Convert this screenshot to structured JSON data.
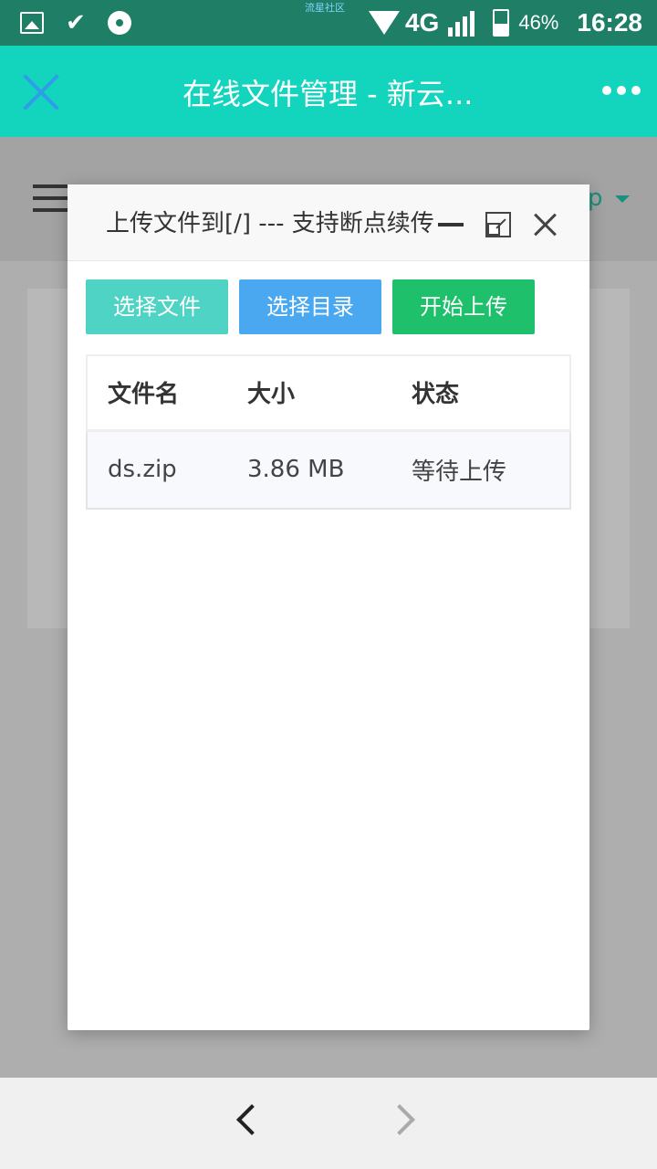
{
  "status_bar": {
    "watermark": "流星社区",
    "network": "4G",
    "battery": "46%",
    "time": "16:28"
  },
  "header": {
    "title": "在线文件管理 - 新云..."
  },
  "background": {
    "user_menu_label": "p"
  },
  "modal": {
    "title": "上传文件到[/] --- 支持断点续传",
    "buttons": {
      "select_file": "选择文件",
      "select_dir": "选择目录",
      "start_upload": "开始上传"
    },
    "table": {
      "columns": [
        "文件名",
        "大小",
        "状态"
      ],
      "rows": [
        {
          "name": "ds.zip",
          "size": "3.86 MB",
          "status": "等待上传"
        }
      ]
    }
  }
}
